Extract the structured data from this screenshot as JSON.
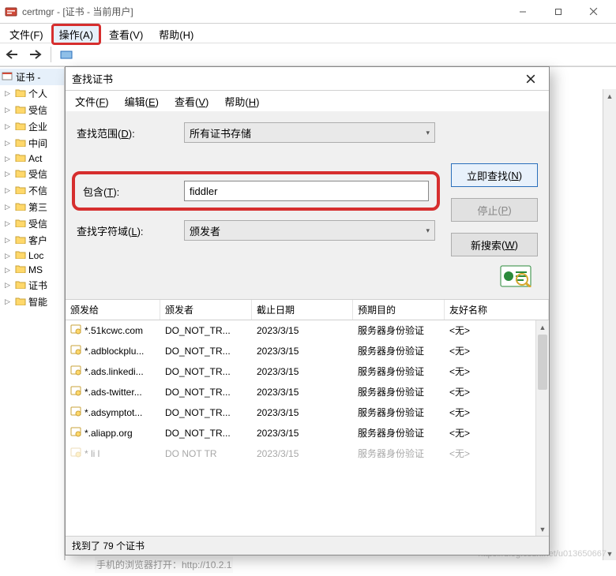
{
  "mmc": {
    "title_app": "certmgr",
    "title_suffix": " - [证书 - 当前用户]",
    "menubar": [
      "文件(F)",
      "操作(A)",
      "查看(V)",
      "帮助(H)"
    ],
    "menubar_highlight_index": 1,
    "tree_root": "证书 - ",
    "tree_items": [
      "个人",
      "受信",
      "企业",
      "中间",
      "Act",
      "受信",
      "不信",
      "第三",
      "受信",
      "客户",
      "Loc",
      "MS",
      "证书",
      "智能"
    ]
  },
  "dialog": {
    "title": "查找证书",
    "menubar": [
      {
        "label": "文件",
        "accel": "F"
      },
      {
        "label": "编辑",
        "accel": "E"
      },
      {
        "label": "查看",
        "accel": "V"
      },
      {
        "label": "帮助",
        "accel": "H"
      }
    ],
    "scope_label": "查找范围",
    "scope_accel": "D",
    "scope_value": "所有证书存储",
    "contains_label": "包含",
    "contains_accel": "T",
    "contains_value": "fiddler",
    "field_label": "查找字符域",
    "field_accel": "L",
    "field_value": "颁发者",
    "buttons": {
      "find_now": {
        "label": "立即查找",
        "accel": "N"
      },
      "stop": {
        "label": "停止",
        "accel": "P"
      },
      "new": {
        "label": "新搜索",
        "accel": "W"
      }
    },
    "columns": [
      "颁发给",
      "颁发者",
      "截止日期",
      "预期目的",
      "友好名称"
    ],
    "rows": [
      {
        "c": [
          "*.51kcwc.com",
          "DO_NOT_TR...",
          "2023/3/15",
          "服务器身份验证",
          "<无>"
        ]
      },
      {
        "c": [
          "*.adblockplu...",
          "DO_NOT_TR...",
          "2023/3/15",
          "服务器身份验证",
          "<无>"
        ]
      },
      {
        "c": [
          "*.ads.linkedi...",
          "DO_NOT_TR...",
          "2023/3/15",
          "服务器身份验证",
          "<无>"
        ]
      },
      {
        "c": [
          "*.ads-twitter...",
          "DO_NOT_TR...",
          "2023/3/15",
          "服务器身份验证",
          "<无>"
        ]
      },
      {
        "c": [
          "*.adsymptot...",
          "DO_NOT_TR...",
          "2023/3/15",
          "服务器身份验证",
          "<无>"
        ]
      },
      {
        "c": [
          "*.aliapp.org",
          "DO_NOT_TR...",
          "2023/3/15",
          "服务器身份验证",
          "<无>"
        ]
      }
    ],
    "row_partial": {
      "c": [
        "* li  l",
        "DO NOT TR",
        "2023/3/15",
        "服务器身份验证",
        "<无>"
      ]
    },
    "status": "找到了 79 个证书"
  },
  "misc": {
    "bottom_hint": "手机的浏览器打开：http://10.2.1",
    "watermark": "https://blog.csdn.net/u013650667"
  }
}
